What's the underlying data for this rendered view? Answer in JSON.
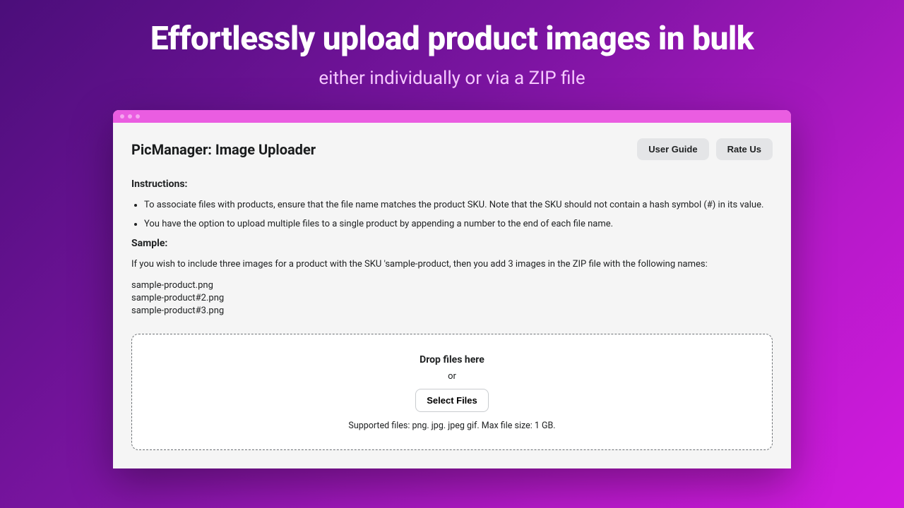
{
  "hero": {
    "title": "Effortlessly upload product images in bulk",
    "subtitle": "either individually or via a ZIP file"
  },
  "app": {
    "title": "PicManager: Image Uploader"
  },
  "buttons": {
    "user_guide": "User Guide",
    "rate_us": "Rate Us"
  },
  "instructions": {
    "heading": "Instructions:",
    "items": [
      "To associate files with products, ensure that the file name matches the product SKU. Note that the SKU should not contain a hash symbol (#) in its value.",
      "You have the option to upload multiple files to a single product by appending a number to the end of each file name."
    ]
  },
  "sample": {
    "heading": "Sample:",
    "intro": "If you wish to include three images for a product with the SKU 'sample-product, then you add 3 images in the ZIP file with the following names:",
    "files": "sample-product.png\nsample-product#2.png\nsample-product#3.png"
  },
  "dropzone": {
    "title": "Drop files here",
    "or": "or",
    "select": "Select Files",
    "supported": "Supported files: png. jpg. jpeg gif. Max file size: 1 GB."
  }
}
